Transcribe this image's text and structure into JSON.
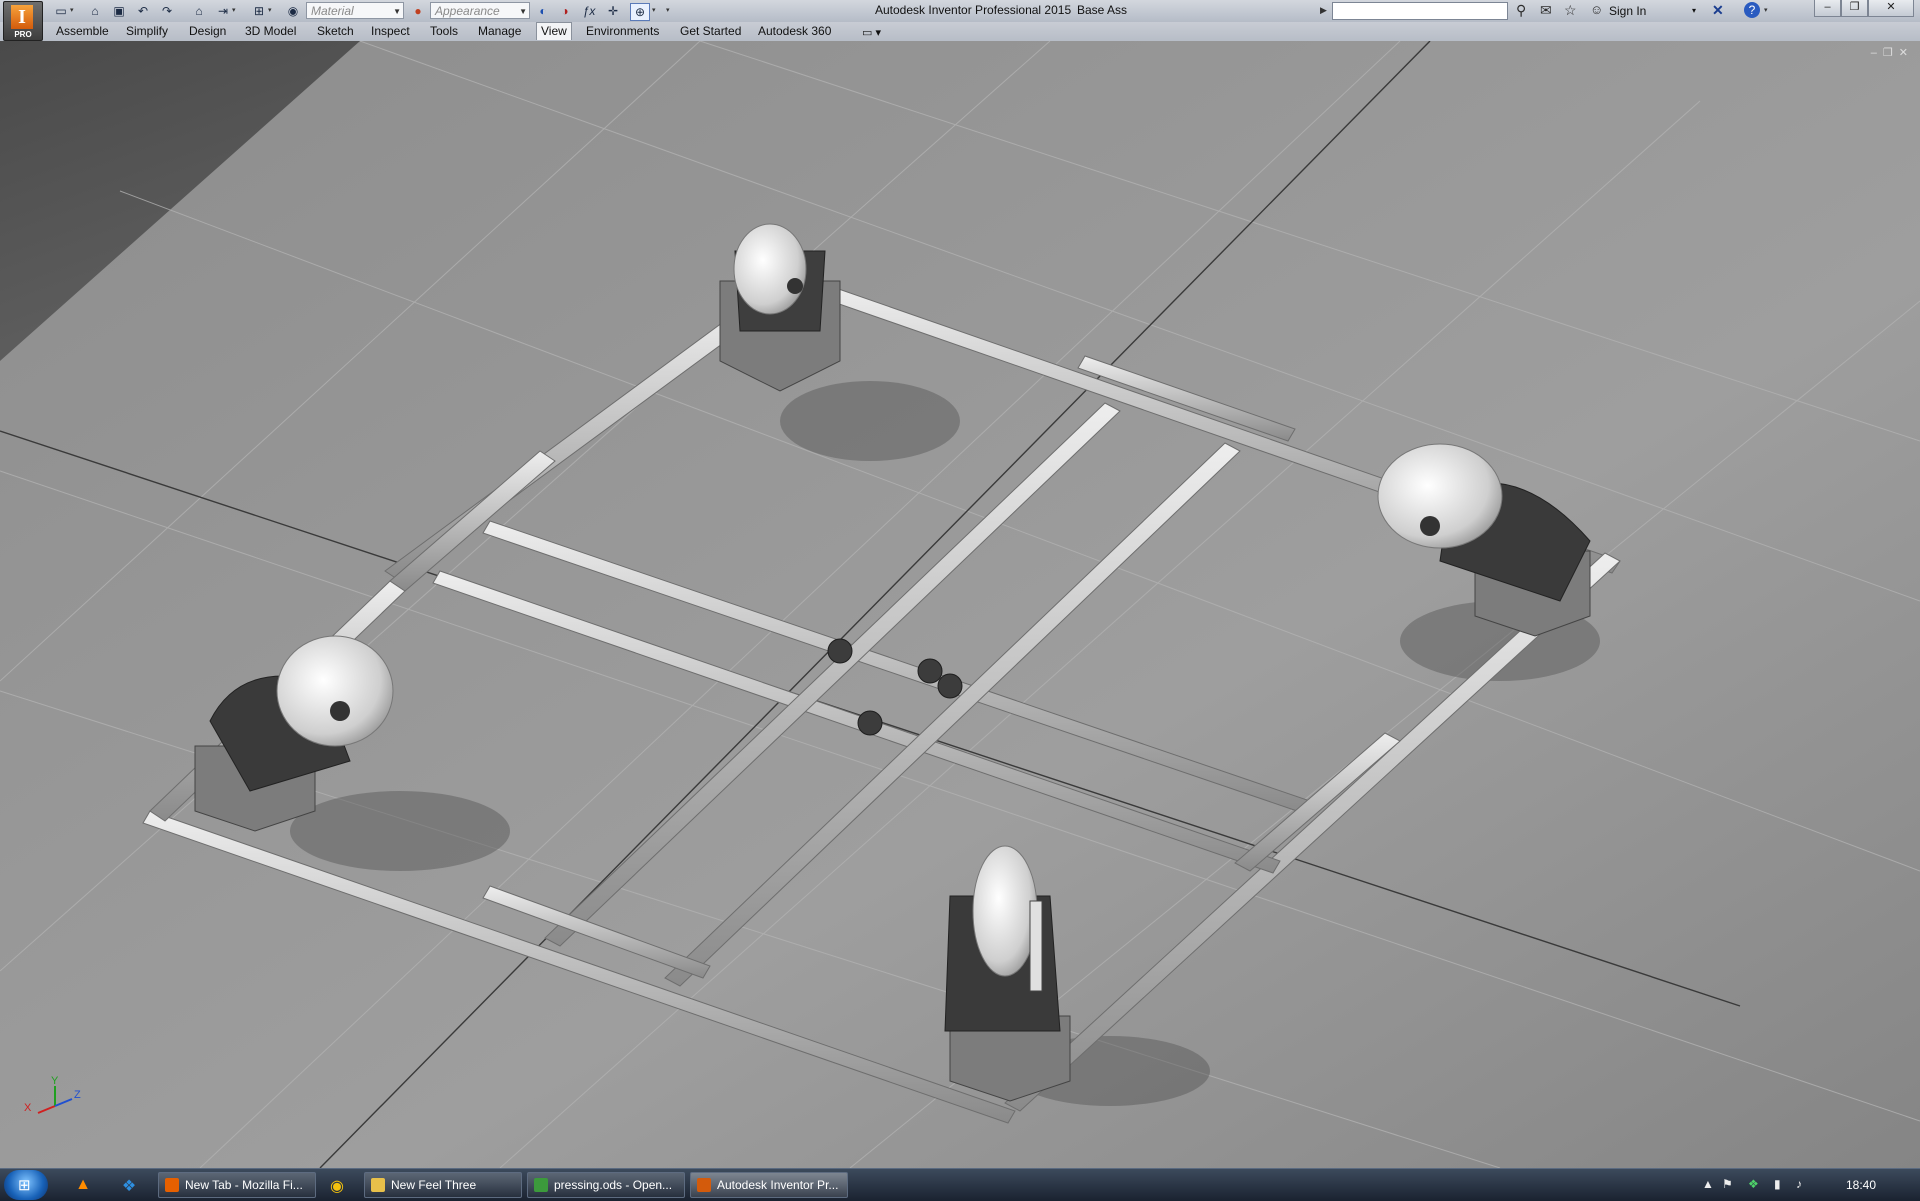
{
  "title_bar": {
    "app_logo_letter": "I",
    "app_logo_badge": "PRO",
    "material_placeholder": "Material",
    "appearance_placeholder": "Appearance",
    "window_title": "Autodesk Inventor Professional 2015",
    "document_name": "Base Ass",
    "sign_in_label": "Sign In",
    "help_label": "?"
  },
  "ribbon_tabs": [
    {
      "label": "Assemble"
    },
    {
      "label": "Simplify"
    },
    {
      "label": "Design"
    },
    {
      "label": "3D Model"
    },
    {
      "label": "Sketch"
    },
    {
      "label": "Inspect"
    },
    {
      "label": "Tools"
    },
    {
      "label": "Manage"
    },
    {
      "label": "View",
      "active": true
    },
    {
      "label": "Environments"
    },
    {
      "label": "Get Started"
    },
    {
      "label": "Autodesk 360"
    }
  ],
  "viewport": {
    "triad_labels": [
      "X",
      "Y",
      "Z"
    ]
  },
  "taskbar": {
    "tasks": [
      {
        "label": "New Tab - Mozilla Fi...",
        "icon": "firefox-icon",
        "color": "#e66000"
      },
      {
        "label": "New Feel Three",
        "icon": "folder-icon",
        "color": "#e8c04a"
      },
      {
        "label": "pressing.ods - Open...",
        "icon": "spreadsheet-icon",
        "color": "#3c9a3c"
      },
      {
        "label": "Autodesk Inventor Pr...",
        "icon": "inventor-icon",
        "color": "#d35b0c",
        "active": true
      }
    ],
    "clock": "18:40"
  },
  "colors": {
    "ribbon_bg": "#c8ccd4",
    "viewport_bg": "#7a7a7a",
    "aluminum_profile": "#c9c9c9",
    "taskbar_bg": "#1a2230",
    "inventor_orange": "#d35b0c"
  }
}
